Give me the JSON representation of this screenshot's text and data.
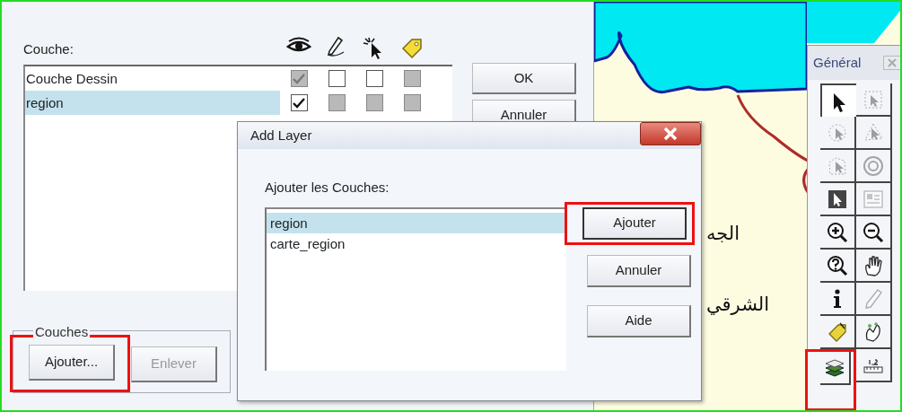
{
  "layer_control": {
    "label": "Couche:",
    "layers": [
      {
        "name": "Couche Dessin",
        "selected": false,
        "flags": [
          {
            "checked": true,
            "disabled": true
          },
          {
            "checked": false,
            "disabled": false
          },
          {
            "checked": false,
            "disabled": false
          },
          {
            "checked": false,
            "disabled": true
          }
        ]
      },
      {
        "name": "region",
        "selected": true,
        "flags": [
          {
            "checked": true,
            "disabled": false
          },
          {
            "checked": false,
            "disabled": true
          },
          {
            "checked": false,
            "disabled": true
          },
          {
            "checked": false,
            "disabled": true
          }
        ]
      }
    ],
    "buttons": [
      {
        "label": "OK"
      },
      {
        "label": "Annuler"
      }
    ],
    "group": {
      "label": "Couches",
      "buttons": [
        {
          "label": "Ajouter...",
          "disabled": false,
          "highlighted": true
        },
        {
          "label": "Enlever",
          "disabled": true,
          "highlighted": false
        }
      ]
    }
  },
  "map": {
    "labels": [
      "الجه",
      "الشرقي"
    ]
  },
  "add_layer_dialog": {
    "title": "Add Layer",
    "label": "Ajouter les Couches:",
    "items": [
      {
        "name": "region",
        "selected": true
      },
      {
        "name": "carte_region",
        "selected": false
      }
    ],
    "buttons": [
      {
        "label": "Ajouter",
        "default": true,
        "highlighted": true
      },
      {
        "label": "Annuler",
        "default": false,
        "highlighted": false
      },
      {
        "label": "Aide",
        "default": false,
        "highlighted": false
      }
    ]
  },
  "tool_palette": {
    "title": "Général",
    "tools": [
      {
        "kind": "arrow",
        "selected": true,
        "disabled": false,
        "highlighted": false
      },
      {
        "kind": "marquee",
        "selected": false,
        "disabled": true,
        "highlighted": false
      },
      {
        "kind": "radius",
        "selected": false,
        "disabled": true,
        "highlighted": false
      },
      {
        "kind": "polygon",
        "selected": false,
        "disabled": true,
        "highlighted": false
      },
      {
        "kind": "boundary",
        "selected": false,
        "disabled": true,
        "highlighted": false
      },
      {
        "kind": "target",
        "selected": false,
        "disabled": true,
        "highlighted": false
      },
      {
        "kind": "invert",
        "selected": false,
        "disabled": false,
        "highlighted": false
      },
      {
        "kind": "layout",
        "selected": false,
        "disabled": true,
        "highlighted": false
      },
      {
        "kind": "zoomin",
        "selected": false,
        "disabled": false,
        "highlighted": false
      },
      {
        "kind": "zoomout",
        "selected": false,
        "disabled": false,
        "highlighted": false
      },
      {
        "kind": "query",
        "selected": false,
        "disabled": false,
        "highlighted": false
      },
      {
        "kind": "hand",
        "selected": false,
        "disabled": false,
        "highlighted": false
      },
      {
        "kind": "info",
        "selected": false,
        "disabled": false,
        "highlighted": false
      },
      {
        "kind": "pencil",
        "selected": false,
        "disabled": true,
        "highlighted": false
      },
      {
        "kind": "label",
        "selected": false,
        "disabled": false,
        "highlighted": false
      },
      {
        "kind": "drag",
        "selected": false,
        "disabled": false,
        "highlighted": false
      },
      {
        "kind": "layers",
        "selected": false,
        "disabled": false,
        "highlighted": true
      },
      {
        "kind": "ruler",
        "selected": false,
        "disabled": false,
        "highlighted": false
      }
    ]
  }
}
